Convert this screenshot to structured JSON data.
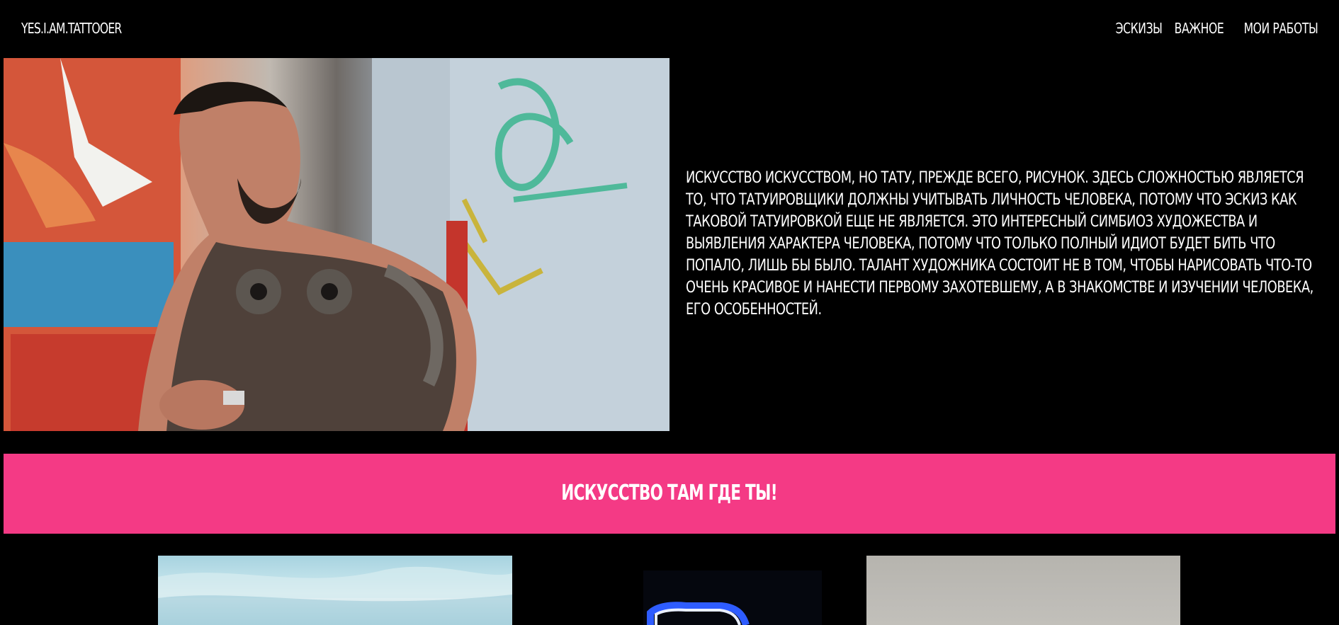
{
  "header": {
    "logo": "YES.I.AM.TATTOOER",
    "nav": [
      {
        "label": "ЭСКИЗЫ"
      },
      {
        "label": "ВАЖНОЕ"
      },
      {
        "label": "МОИ РАБОТЫ"
      }
    ]
  },
  "hero": {
    "text": "ИСКУССТВО ИСКУССТВОМ, НО ТАТУ, ПРЕЖДЕ ВСЕГО, РИСУНОК. ЗДЕСЬ СЛОЖНОСТЬЮ ЯВЛЯЕТСЯ ТО, ЧТО ТАТУИРОВЩИКИ ДОЛЖНЫ УЧИТЫВАТЬ ЛИЧНОСТЬ ЧЕЛОВЕКА, ПОТОМУ ЧТО ЭСКИЗ КАК ТАКОВОЙ ТАТУИРОВКОЙ ЕЩЕ НЕ ЯВЛЯЕТСЯ. ЭТО ИНТЕРЕСНЫЙ СИМБИОЗ ХУДОЖЕСТВА И ВЫЯВЛЕНИЯ ХАРАКТЕРА ЧЕЛОВЕКА, ПОТОМУ ЧТО ТОЛЬКО ПОЛНЫЙ ИДИОТ БУДЕТ БИТЬ ЧТО ПОПАЛО, ЛИШЬ БЫ БЫЛО. ТАЛАНТ ХУДОЖНИКА СОСТОИТ НЕ В ТОМ, ЧТОБЫ НАРИСОВАТЬ ЧТО-ТО ОЧЕНЬ КРАСИВОЕ И НАНЕСТИ ПЕРВОМУ ЗАХОТЕВШЕМУ, А В ЗНАКОМСТВЕ И ИЗУЧЕНИИ ЧЕЛОВЕКА, ЕГО ОСОБЕННОСТЕЙ."
  },
  "banner": {
    "title": "ИСКУССТВО ТАМ ГДЕ ТЫ!",
    "color": "#f43a85"
  },
  "colors": {
    "background": "#000000",
    "text": "#ffffff",
    "accent": "#f43a85"
  }
}
